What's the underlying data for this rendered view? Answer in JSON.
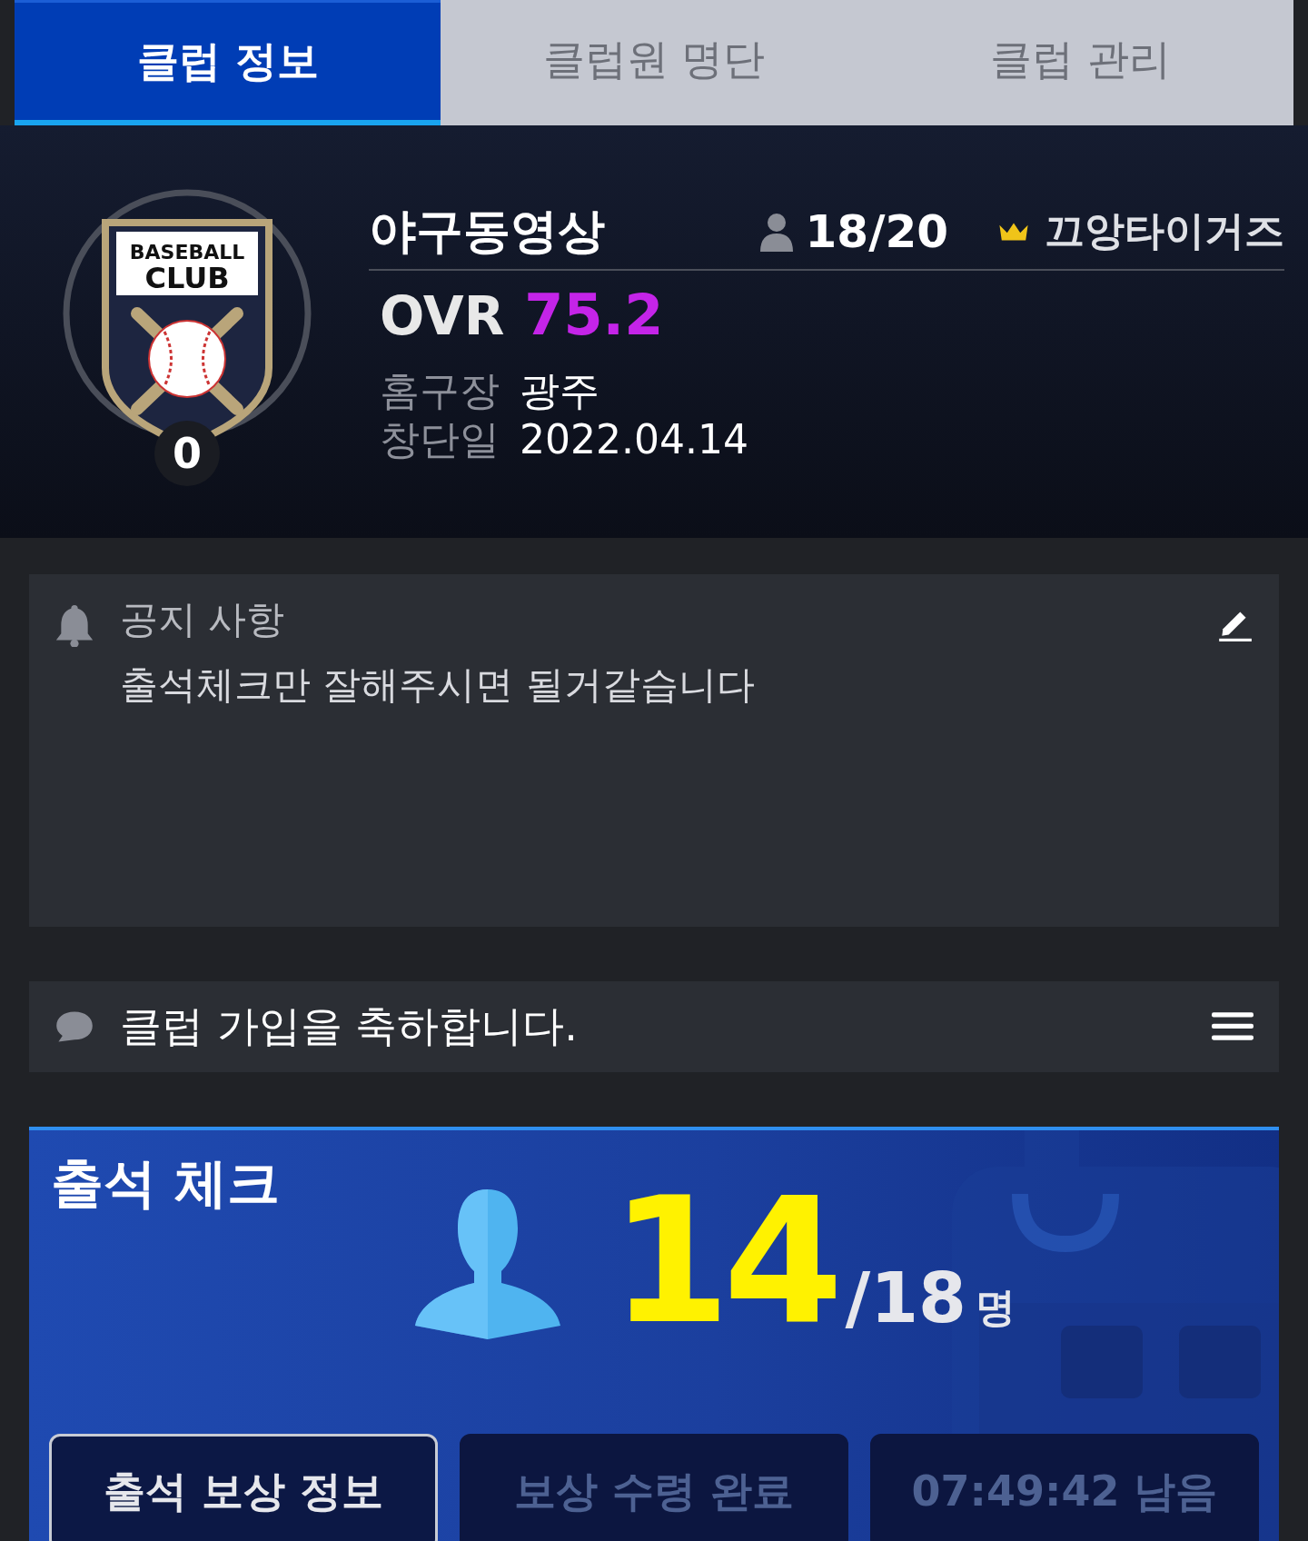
{
  "tabs": [
    {
      "label": "클럽 정보",
      "selected": true
    },
    {
      "label": "클럽원 명단",
      "selected": false
    },
    {
      "label": "클럽 관리",
      "selected": false
    }
  ],
  "club": {
    "logo_lines": [
      "BASEBALL",
      "CLUB"
    ],
    "level": "0",
    "name": "야구동영상",
    "members": "18/20",
    "leader": "끄앙타이거즈",
    "ovr_label": "OVR",
    "ovr": "75.2",
    "details": [
      {
        "label": "홈구장",
        "value": "광주"
      },
      {
        "label": "창단일",
        "value": "2022.04.14"
      }
    ]
  },
  "notice": {
    "title": "공지 사항",
    "text": "출석체크만 잘해주시면 될거같습니다"
  },
  "chat": {
    "message": "클럽 가입을 축하합니다."
  },
  "attendance": {
    "title": "출석 체크",
    "count": "14",
    "total": "/18",
    "unit": "명",
    "buttons": [
      {
        "label": "출석 보상 정보",
        "disabled": false
      },
      {
        "label": "보상 수령 완료",
        "disabled": true
      },
      {
        "label": "07:49:42 남음",
        "disabled": true
      }
    ]
  }
}
